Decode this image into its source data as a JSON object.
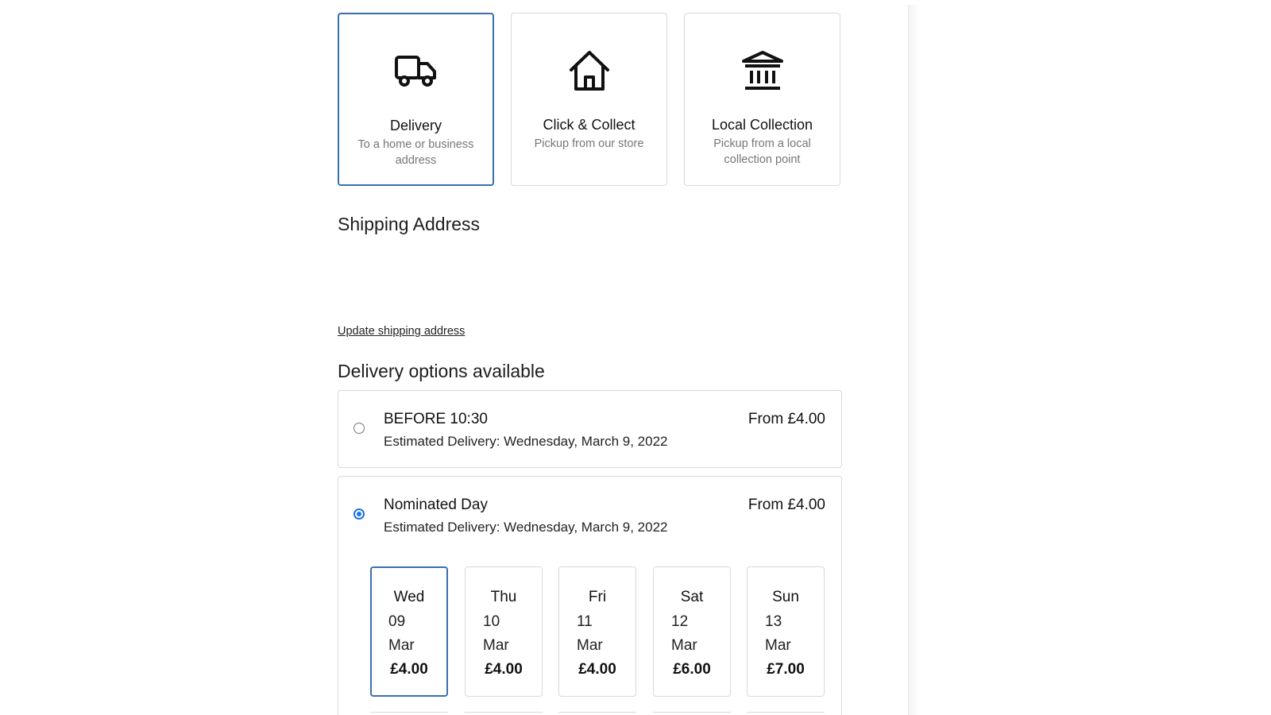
{
  "delivery_methods": [
    {
      "title": "Delivery",
      "subtitle": "To a home or business address",
      "icon": "truck-icon",
      "selected": true
    },
    {
      "title": "Click & Collect",
      "subtitle": "Pickup from our store",
      "icon": "house-icon",
      "selected": false
    },
    {
      "title": "Local Collection",
      "subtitle": "Pickup from a local collection point",
      "icon": "bank-building-icon",
      "selected": false
    }
  ],
  "shipping": {
    "heading": "Shipping Address",
    "update_link": "Update shipping address"
  },
  "delivery_options": {
    "heading": "Delivery options available",
    "options": [
      {
        "name": "BEFORE 10:30",
        "estimate": "Estimated Delivery: Wednesday, March 9, 2022",
        "price": "From £4.00",
        "selected": false
      },
      {
        "name": "Nominated Day",
        "estimate": "Estimated Delivery: Wednesday, March 9, 2022",
        "price": "From £4.00",
        "selected": true
      }
    ]
  },
  "nominated_days": [
    {
      "day": "Wed",
      "date": "09",
      "month": "Mar",
      "price": "£4.00",
      "selected": true
    },
    {
      "day": "Thu",
      "date": "10",
      "month": "Mar",
      "price": "£4.00",
      "selected": false
    },
    {
      "day": "Fri",
      "date": "11",
      "month": "Mar",
      "price": "£4.00",
      "selected": false
    },
    {
      "day": "Sat",
      "date": "12",
      "month": "Mar",
      "price": "£6.00",
      "selected": false
    },
    {
      "day": "Sun",
      "date": "13",
      "month": "Mar",
      "price": "£7.00",
      "selected": false
    }
  ],
  "colors": {
    "selected_border": "#3a6fb0",
    "radio_checked": "#1a73e8",
    "muted_text": "#767676",
    "card_border": "#d9d9d9"
  }
}
